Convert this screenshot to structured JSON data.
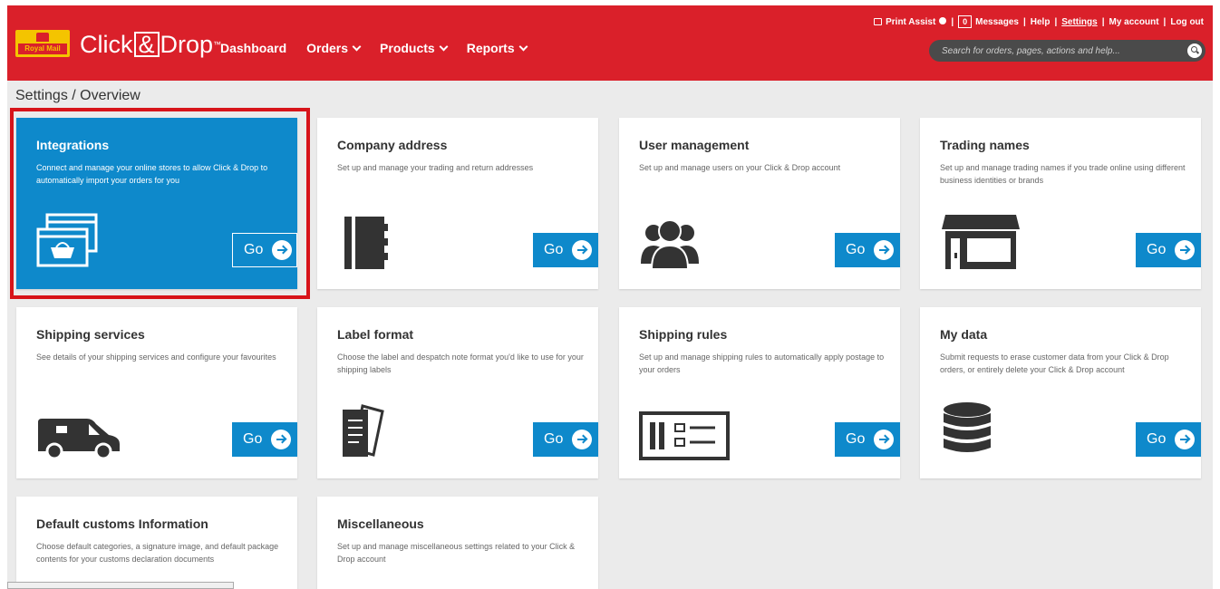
{
  "header": {
    "logo_text": "Royal Mail",
    "brand": {
      "left": "Click",
      "amp": "&",
      "right": "Drop",
      "tm": "™"
    },
    "nav": [
      {
        "label": "Dashboard",
        "dropdown": false
      },
      {
        "label": "Orders",
        "dropdown": true
      },
      {
        "label": "Products",
        "dropdown": true
      },
      {
        "label": "Reports",
        "dropdown": true
      }
    ],
    "utility": {
      "print_assist": "Print Assist",
      "messages_count": "0",
      "messages": "Messages",
      "help": "Help",
      "settings": "Settings",
      "my_account": "My account",
      "log_out": "Log out",
      "separator": "|"
    },
    "search_placeholder": "Search for orders, pages, actions and help..."
  },
  "breadcrumb": "Settings / Overview",
  "go_label": "Go",
  "cards": [
    {
      "title": "Integrations",
      "desc": "Connect and manage your online stores to allow Click & Drop to automatically import your orders for you",
      "icon": "integrations-icon",
      "highlighted": true
    },
    {
      "title": "Company address",
      "desc": "Set up and manage your trading and return addresses",
      "icon": "address-book-icon",
      "highlighted": false
    },
    {
      "title": "User management",
      "desc": "Set up and manage users on your Click & Drop account",
      "icon": "users-icon",
      "highlighted": false
    },
    {
      "title": "Trading names",
      "desc": "Set up and manage trading names if you trade online using different business identities or brands",
      "icon": "shop-front-icon",
      "highlighted": false
    },
    {
      "title": "Shipping services",
      "desc": "See details of your shipping services and configure your favourites",
      "icon": "van-icon",
      "highlighted": false
    },
    {
      "title": "Label format",
      "desc": "Choose the label and despatch note format you'd like to use for your shipping labels",
      "icon": "documents-icon",
      "highlighted": false
    },
    {
      "title": "Shipping rules",
      "desc": "Set up and manage shipping rules to automatically apply postage to your orders",
      "icon": "rules-icon",
      "highlighted": false
    },
    {
      "title": "My data",
      "desc": "Submit requests to erase customer data from your Click & Drop orders, or entirely delete your Click & Drop account",
      "icon": "database-icon",
      "highlighted": false
    },
    {
      "title": "Default customs Information",
      "desc": "Choose default categories, a signature image, and default package contents for your customs declaration documents",
      "icon": "",
      "highlighted": false
    },
    {
      "title": "Miscellaneous",
      "desc": "Set up and manage miscellaneous settings related to your Click & Drop account",
      "icon": "",
      "highlighted": false
    }
  ],
  "colors": {
    "brand_red": "#da202a",
    "accent_blue": "#0e89cb",
    "logo_yellow": "#f4c400",
    "highlight_border": "#d7141a"
  }
}
